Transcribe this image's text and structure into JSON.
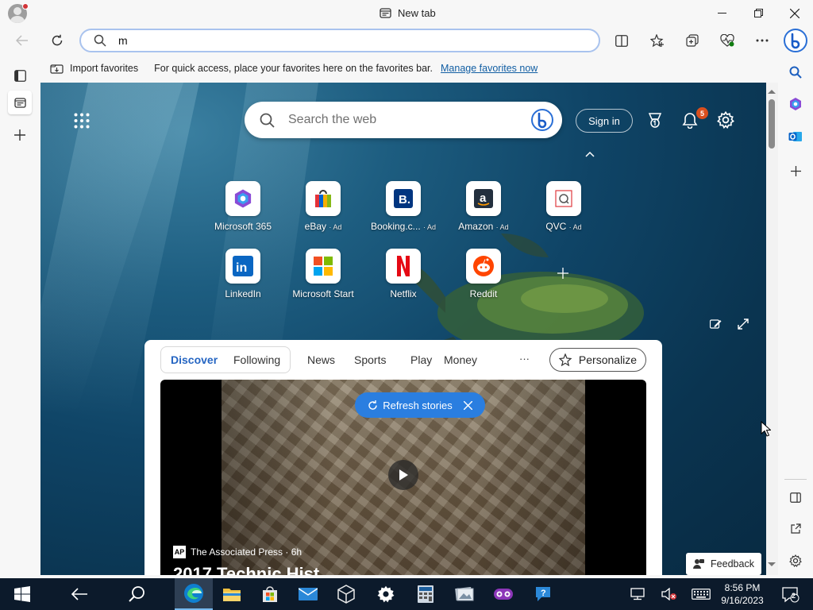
{
  "window": {
    "tab_title": "New tab"
  },
  "address_bar": {
    "value": "m"
  },
  "favorites_bar": {
    "import_label": "Import favorites",
    "message": "For quick access, place your favorites here on the favorites bar.",
    "manage_link": "Manage favorites now"
  },
  "ntp": {
    "search_placeholder": "Search the web",
    "sign_in": "Sign in",
    "notification_count": "5",
    "quick_links": [
      {
        "label": "Microsoft 365",
        "ad": ""
      },
      {
        "label": "eBay",
        "ad": "· Ad"
      },
      {
        "label": "Booking.c...",
        "ad": "· Ad"
      },
      {
        "label": "Amazon",
        "ad": "· Ad"
      },
      {
        "label": "QVC",
        "ad": "· Ad"
      },
      {
        "label": "LinkedIn",
        "ad": ""
      },
      {
        "label": "Microsoft Start",
        "ad": ""
      },
      {
        "label": "Netflix",
        "ad": ""
      },
      {
        "label": "Reddit",
        "ad": ""
      }
    ]
  },
  "feed": {
    "tabs": [
      "Discover",
      "Following"
    ],
    "categories": [
      "News",
      "Sports",
      "Play",
      "Money"
    ],
    "more": "···",
    "personalize": "Personalize",
    "refresh_stories": "Refresh stories",
    "source_logo": "AP",
    "source": "The Associated Press · 6h",
    "headline": "2017 Technic Hist"
  },
  "feedback": "Feedback",
  "taskbar": {
    "time": "8:56 PM",
    "date": "9/16/2023",
    "notif_count": "2"
  },
  "colors": {
    "accent": "#115ea3",
    "refresh": "#2a7ee0",
    "taskbar": "#0c1a2b"
  }
}
